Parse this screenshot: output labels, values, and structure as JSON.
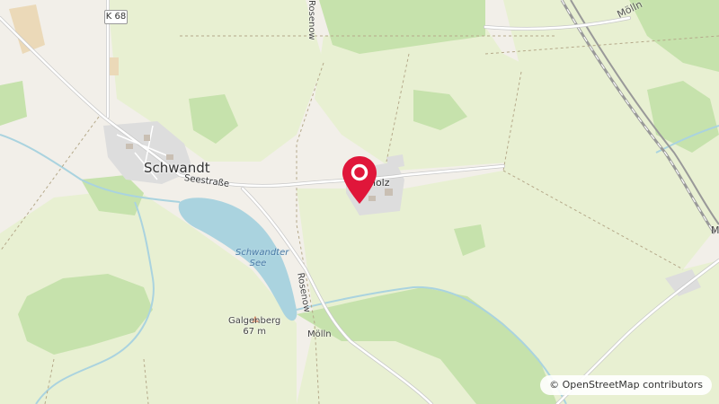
{
  "map": {
    "road_shield": "K 68",
    "village_name": "Schwandt",
    "street_name": "Seestraße",
    "locality_name": "Buchholz",
    "locality_partial_label": "nholz",
    "lake_name_line1": "Schwandter",
    "lake_name_line2": "See",
    "road_name_rosenow_top": "Rosenow",
    "road_name_rosenow_mid": "Rosenow",
    "road_name_molln_bottom": "Mölln",
    "road_name_molln_topright": "Mölln",
    "edge_label_right": "M",
    "peak_name": "Galgenberg",
    "peak_elevation": "67 m",
    "marker_icon": "location-pin-icon",
    "marker_color": "#e0163a"
  },
  "attribution": {
    "text": "© OpenStreetMap contributors"
  },
  "colors": {
    "land": "#f2efe9",
    "meadow": "#e6efcf",
    "forest": "#c9e3b3",
    "water": "#aad3df",
    "residential": "#dcdcdc",
    "road": "#ffffff",
    "rail": "#999999"
  }
}
